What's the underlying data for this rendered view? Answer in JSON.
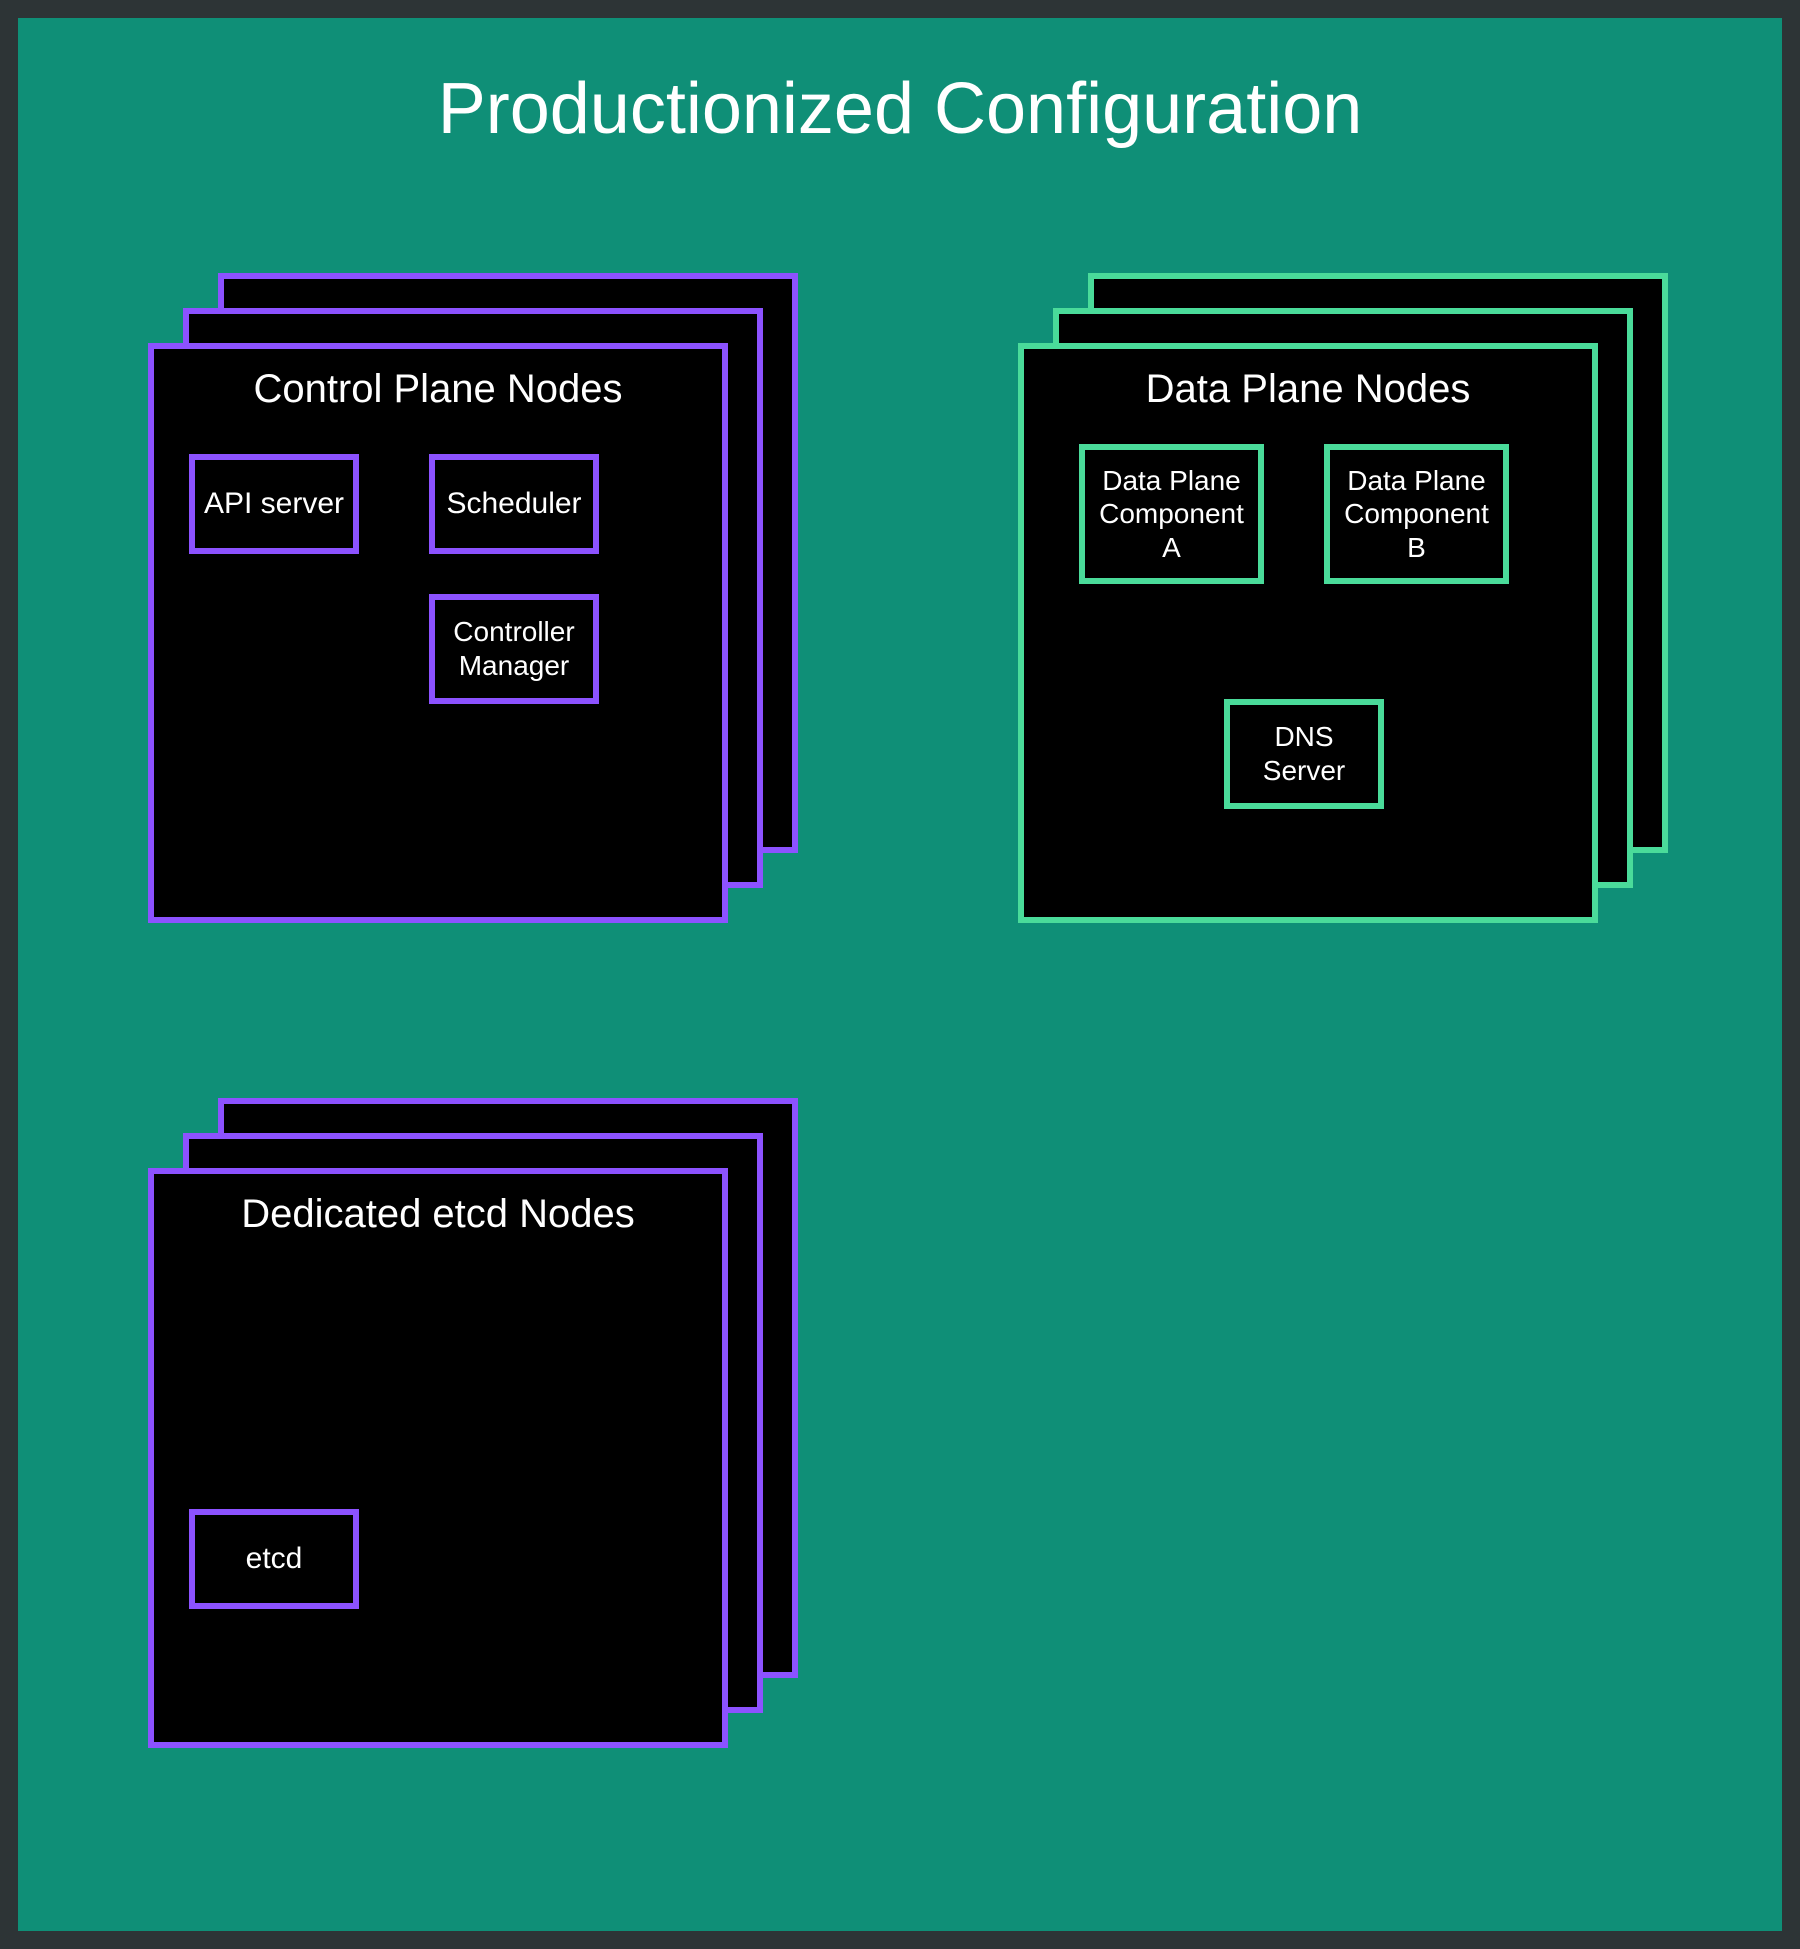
{
  "title": "Productionized Configuration",
  "control_plane": {
    "title": "Control Plane Nodes",
    "components": {
      "api": "API server",
      "scheduler": "Scheduler",
      "controller_manager": "Controller\nManager"
    }
  },
  "data_plane": {
    "title": "Data Plane Nodes",
    "components": {
      "comp_a": "Data Plane\nComponent\nA",
      "comp_b": "Data Plane\nComponent\nB",
      "dns": "DNS\nServer"
    }
  },
  "etcd": {
    "title": "Dedicated etcd Nodes",
    "components": {
      "etcd": "etcd"
    }
  },
  "colors": {
    "background": "#0f8f77",
    "outer": "#2d3436",
    "purple": "#8c52ff",
    "green": "#4adb9a",
    "card_bg": "#000000",
    "text": "#ffffff"
  }
}
